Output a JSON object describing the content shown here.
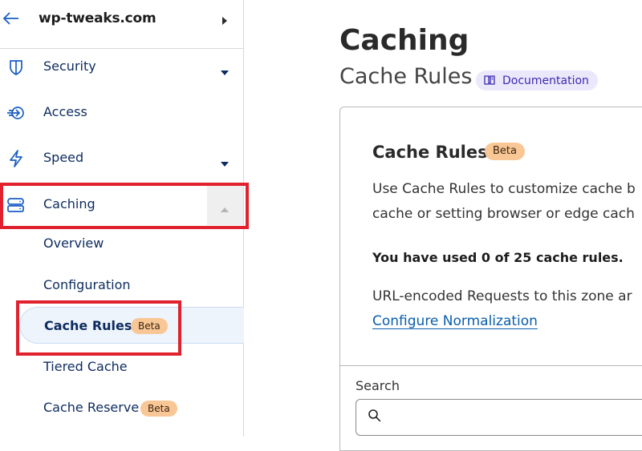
{
  "sidebar": {
    "zone_name": "wp-tweaks.com",
    "nav": [
      {
        "label": "Security",
        "icon": "shield-icon",
        "expandable": true
      },
      {
        "label": "Access",
        "icon": "access-icon",
        "expandable": false
      },
      {
        "label": "Speed",
        "icon": "lightning-icon",
        "expandable": true
      },
      {
        "label": "Caching",
        "icon": "server-stack-icon",
        "expanded": true
      }
    ],
    "caching_children": [
      {
        "label": "Overview"
      },
      {
        "label": "Configuration"
      },
      {
        "label": "Cache Rules",
        "badge": "Beta",
        "active": true
      },
      {
        "label": "Tiered Cache"
      },
      {
        "label": "Cache Reserve",
        "badge": "Beta"
      }
    ]
  },
  "main": {
    "title": "Caching",
    "subtitle": "Cache Rules",
    "doc_link": "Documentation",
    "card": {
      "title": "Cache Rules",
      "badge": "Beta",
      "description_lines": [
        "Use Cache Rules to customize cache b",
        "cache or setting browser or edge cach"
      ],
      "usage": "You have used 0 of 25 cache rules.",
      "url_note": "URL-encoded Requests to this zone ar",
      "configure_link": "Configure Normalization"
    },
    "search": {
      "label": "Search",
      "value": "",
      "placeholder": ""
    }
  },
  "colors": {
    "nav_text": "#0d2b5e",
    "icon_blue": "#1a5fc2",
    "badge_bg": "#f9c796",
    "highlight_red": "#e0222e",
    "active_bg": "#eef4fc",
    "link": "#0a5dad",
    "doc_pill_bg": "#ece8fb"
  }
}
